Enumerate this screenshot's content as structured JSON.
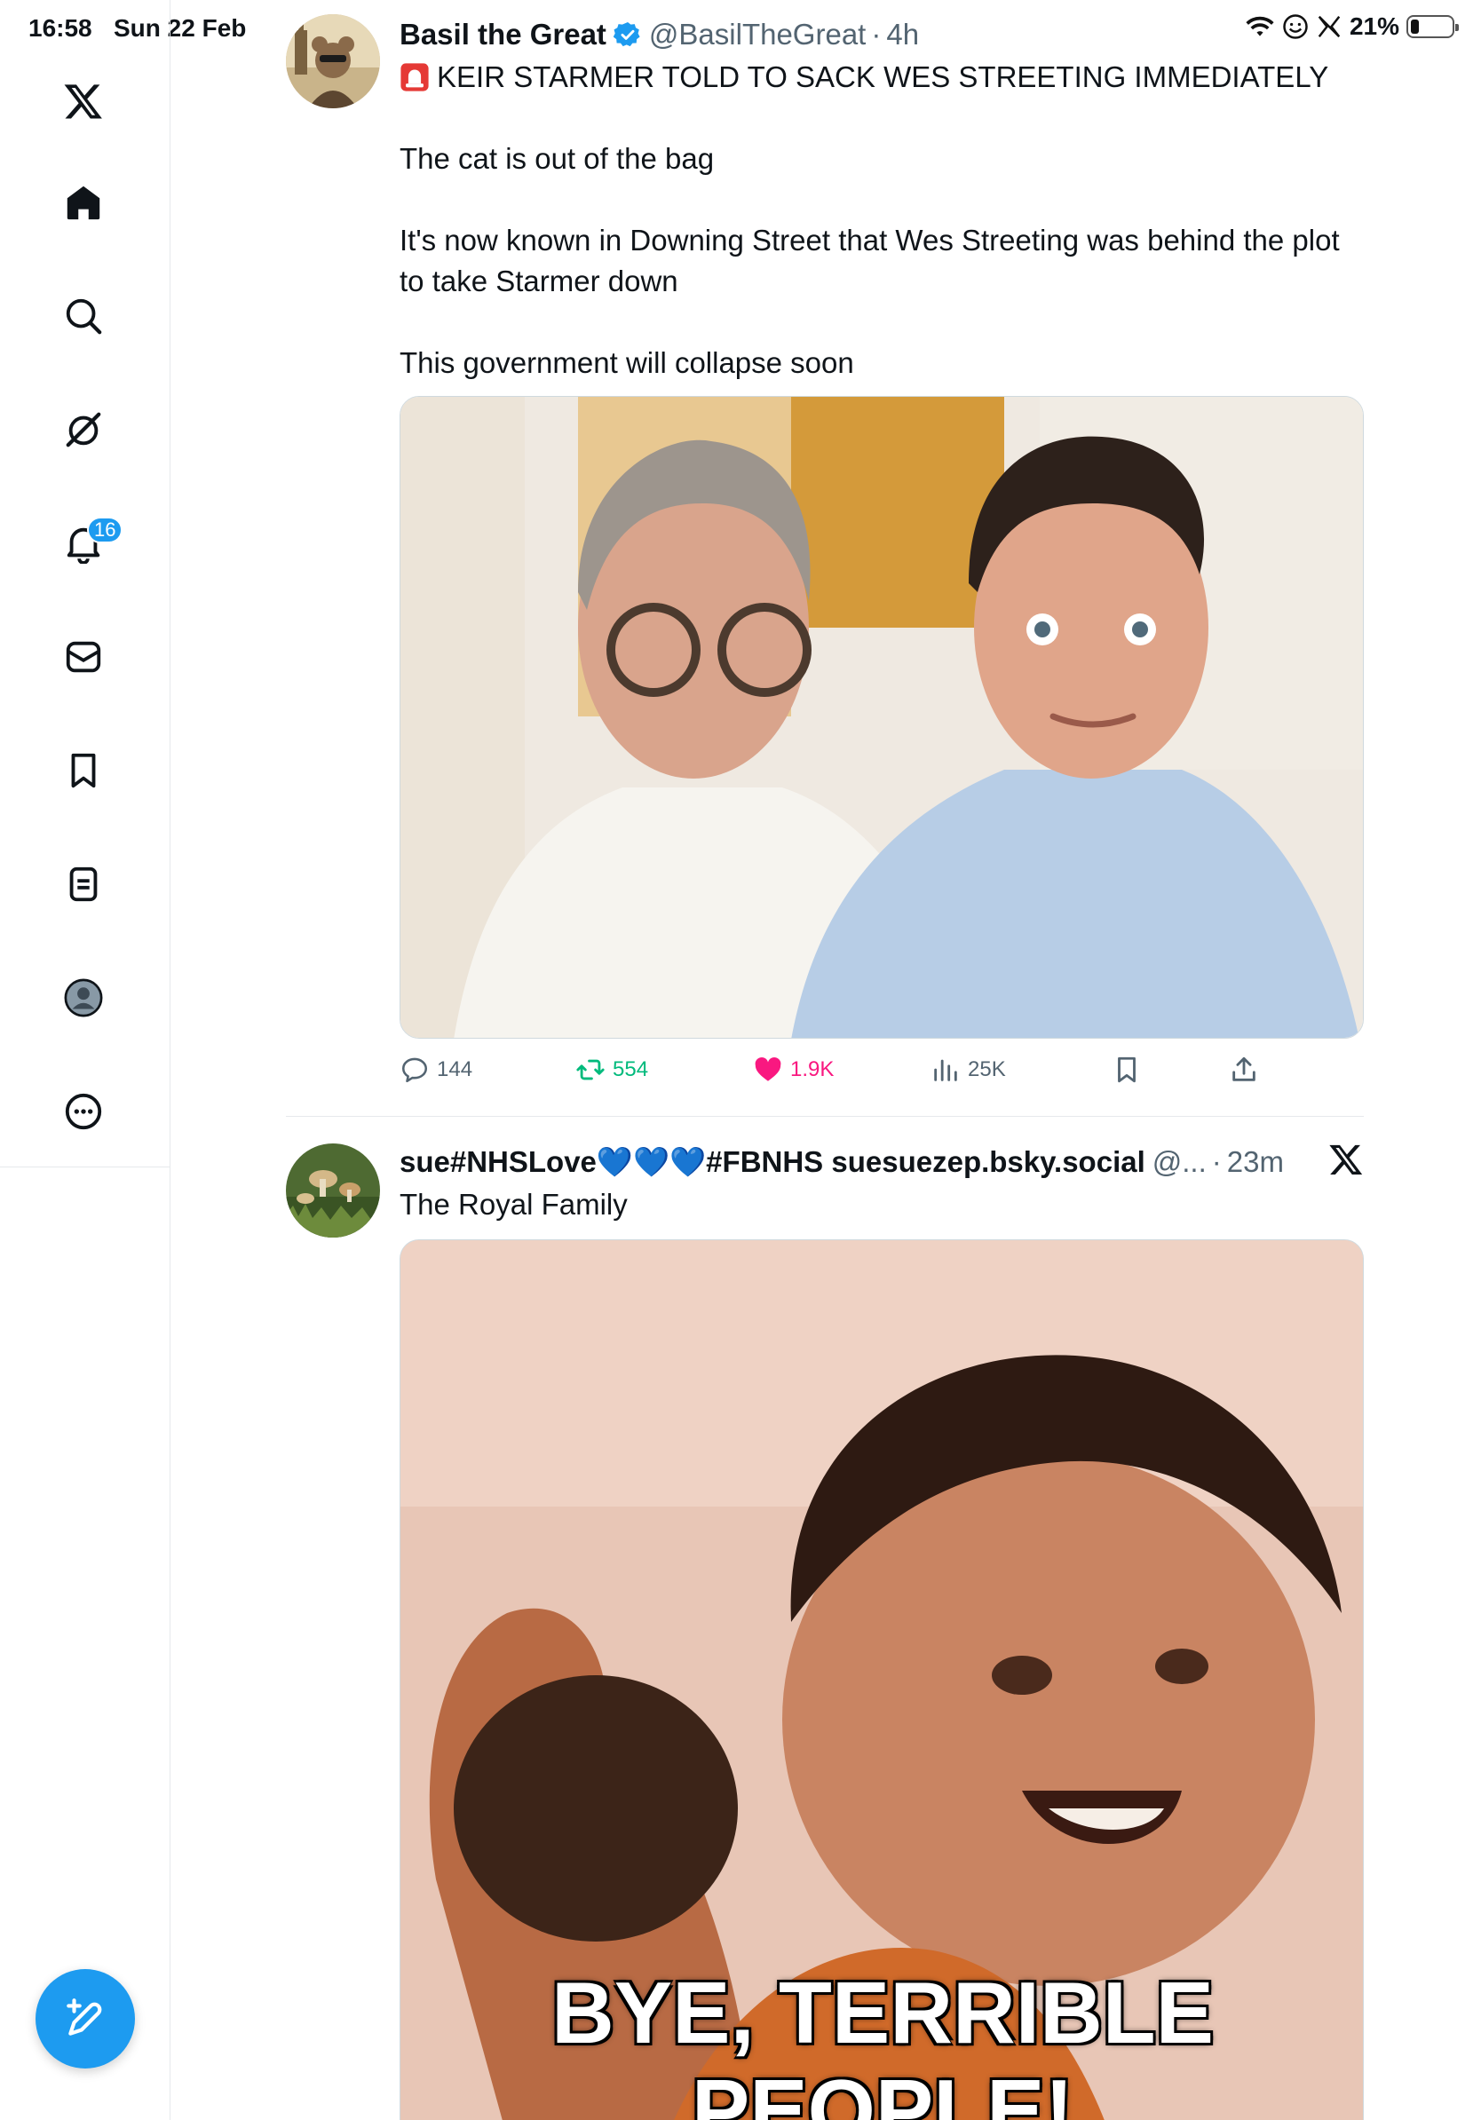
{
  "status_bar": {
    "time": "16:58",
    "date": "Sun 22 Feb",
    "battery": "21%",
    "battery_level": 0.21
  },
  "sidebar": {
    "items": [
      {
        "name": "x-logo-icon"
      },
      {
        "name": "home-icon"
      },
      {
        "name": "search-icon"
      },
      {
        "name": "grok-icon"
      },
      {
        "name": "notifications-icon",
        "badge": "16"
      },
      {
        "name": "messages-icon"
      },
      {
        "name": "bookmarks-icon"
      },
      {
        "name": "lists-icon"
      },
      {
        "name": "profile-icon"
      },
      {
        "name": "more-icon"
      }
    ],
    "accent": "#1d9bf0"
  },
  "tweets": [
    {
      "name": "Basil the Great",
      "handle": "@BasilTheGreat",
      "separator": "·",
      "time": "4h",
      "verified": true,
      "text_lines": [
        "KEIR STARMER TOLD TO SACK WES STREETING IMMEDIATELY",
        "The cat is out of the bag",
        "It's now known in Downing Street that Wes Streeting was behind the plot to take Starmer down",
        "This government will collapse soon"
      ],
      "stats": {
        "replies": "144",
        "reposts": "554",
        "likes": "1.9K",
        "views": "25K"
      },
      "colors": {
        "repost": "#00ba7c",
        "like": "#f91880"
      }
    },
    {
      "name": "sue#NHSLove💙💙💙#FBNHS suesuezep.bsky.social",
      "handle": "@...",
      "separator": "·",
      "time": "23m",
      "verified": false,
      "text_lines": [
        "The Royal Family"
      ],
      "media_caption": [
        "BYE, TERRIBLE",
        "PEOPLE!"
      ]
    }
  ]
}
